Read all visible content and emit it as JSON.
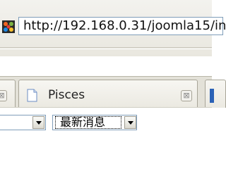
{
  "toolbar": {
    "address": "http://192.168.0.31/joomla15/in",
    "favicon": "joomla-logo-icon"
  },
  "tabs": [
    {
      "label": "",
      "icon": "close-icon"
    },
    {
      "label": "Pisces",
      "icon": "page-icon",
      "close_icon": "close-icon"
    },
    {
      "label": "",
      "icon": "blue-tab-icon"
    }
  ],
  "form": {
    "select1": {
      "value": ""
    },
    "select2": {
      "value": "最新消息"
    }
  },
  "colors": {
    "accent_blue": "#2b62b6",
    "chrome": "#e3e1d8",
    "border": "#7f9db9"
  }
}
